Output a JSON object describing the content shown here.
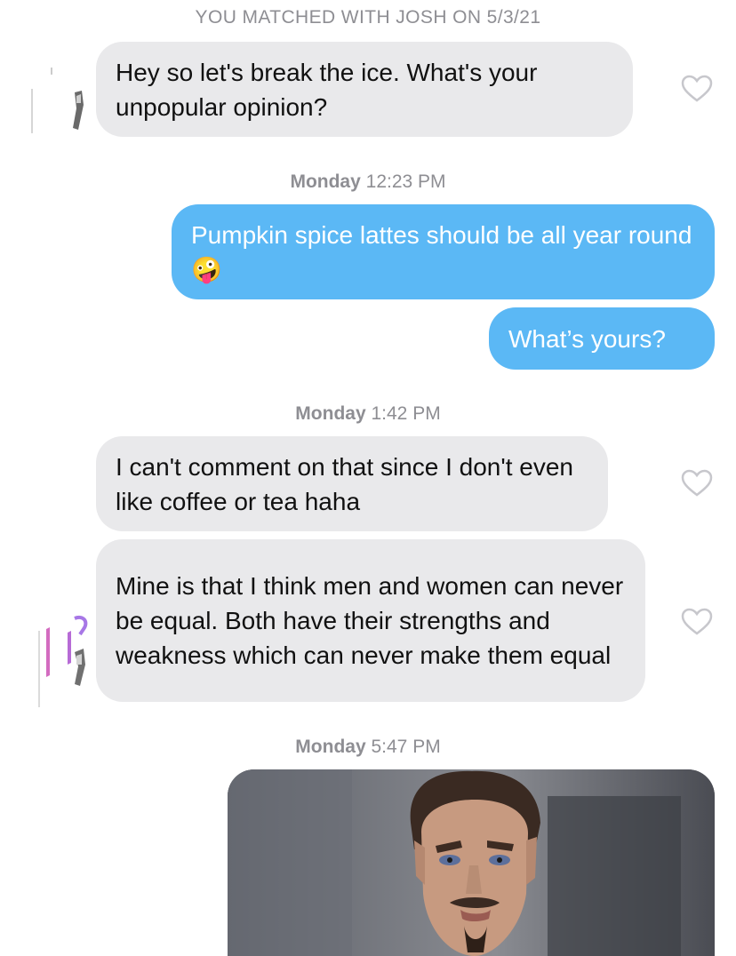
{
  "banner": {
    "text": "YOU MATCHED WITH JOSH ON 5/3/21"
  },
  "messages": [
    {
      "text": "Hey so let's break the ice. What's your unpopular opinion?"
    },
    {
      "day": "Monday",
      "time": "12:23 PM"
    },
    {
      "text": "Pumpkin spice lattes should be all year round",
      "emoji": "🤪"
    },
    {
      "text": "What’s yours?"
    },
    {
      "day": "Monday",
      "time": "1:42 PM"
    },
    {
      "text": "I can't comment on that since I don't even like coffee or tea haha"
    },
    {
      "text": "Mine is that I think men and women can never be equal. Both have their strengths and weakness which can never make them equal"
    },
    {
      "day": "Monday",
      "time": "5:47 PM"
    }
  ],
  "colors": {
    "sent": "#5bb8f5",
    "received": "#e9e9eb",
    "timestamp": "#8e8e93",
    "heart": "#c7c7cc"
  },
  "icons": [
    "heart-icon",
    "avatar"
  ]
}
